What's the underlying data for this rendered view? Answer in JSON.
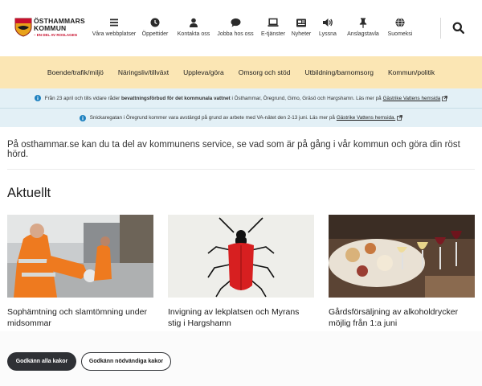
{
  "logo": {
    "name_line1": "ÖSTHAMMARS",
    "name_line2": "KOMMUN",
    "tagline": "– EN DEL AV ROSLAGEN"
  },
  "topnav": [
    {
      "label": "Våra webbplatser",
      "icon": "menu-icon"
    },
    {
      "label": "Öppettider",
      "icon": "clock-icon"
    },
    {
      "label": "Kontakta oss",
      "icon": "person-icon"
    },
    {
      "label": "Jobba hos oss",
      "icon": "chat-icon"
    },
    {
      "label": "E-tjänster",
      "icon": "laptop-icon"
    },
    {
      "label": "Nyheter",
      "icon": "newspaper-icon"
    },
    {
      "label": "Lyssna",
      "icon": "speaker-icon"
    },
    {
      "label": "Anslagstavla",
      "icon": "pin-icon"
    },
    {
      "label": "Suomeksi",
      "icon": "globe-icon"
    }
  ],
  "mainnav": [
    "Boende/trafik/miljö",
    "Näringsliv/tillväxt",
    "Uppleva/göra",
    "Omsorg och stöd",
    "Utbildning/barnomsorg",
    "Kommun/politik"
  ],
  "alerts": [
    {
      "pre": "Från 23 april och tills vidare råder",
      "bold": "bevattningsförbud för det kommunala vattnet",
      "post": "i Östhammar, Öregrund, Gimo, Gräsö och Hargshamn. Läs mer på",
      "link": "Gästrike Vattens hemsida"
    },
    {
      "pre": "Snickaregatan i Öregrund kommer vara avstängd på grund av arbete med VA-nätet den 2-13 juni. Läs mer på",
      "link": "Gästrike Vattens hemsida."
    }
  ],
  "intro": "På osthammar.se kan du ta del av kommunens service, se vad som är på gång i vår kommun och göra din röst hörd.",
  "section_title": "Aktuellt",
  "cards": [
    {
      "title": "Sophämtning och slamtömning under midsommar"
    },
    {
      "title": "Invigning av lekplatsen och Myrans stig i Hargshamn"
    },
    {
      "title": "Gårdsförsäljning av alkoholdrycker möjlig från 1:a juni"
    }
  ],
  "cookie": {
    "accept_all": "Godkänn alla kakor",
    "accept_necessary": "Godkänn nödvändiga kakor"
  },
  "colors": {
    "nav_bg": "#fbe6b4",
    "alert_bg": "#e3f0f6",
    "info_blue": "#1f82c0",
    "dark_button": "#2f3135"
  }
}
